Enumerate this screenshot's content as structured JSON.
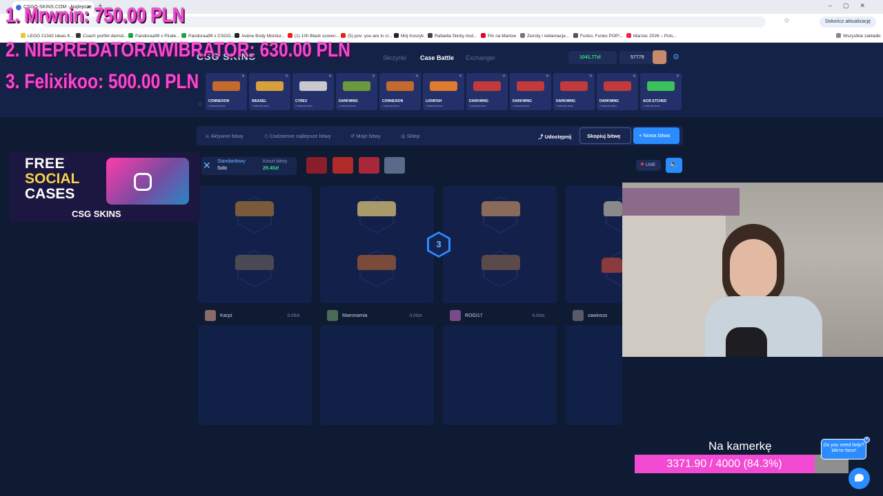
{
  "browser": {
    "tab_title": "CSGO-SKINS.COM - Najlepsze",
    "update_label": "Dokończ aktualizację",
    "bookmarks": [
      "LEGO 21342 Ideas K...",
      "Coach portfel damsk...",
      "Pandoraa99 x Pirate...",
      "Pandoraa99 x CSGO...",
      "Avène Body Moistur...",
      "(1) 10h Black screen...",
      "(5) pov: you are in cl...",
      "Mój Koszyk",
      "Rafaella Slinky And...",
      "Pin na Marlow",
      "Zwroty i reklamacje...",
      "Funko, Funko POP!...",
      "Marzec 2026 – Pols..."
    ],
    "all_bookmarks_label": "Wszystkie zakładki"
  },
  "leaderboard": [
    {
      "rank": "1. Mrwnin:",
      "amount": "750.00 PLN"
    },
    {
      "rank": "2. NIEPREDATORAWIBRATOR:",
      "amount": "630.00 PLN"
    },
    {
      "rank": "3. Felixikoo:",
      "amount": "500.00 PLN"
    }
  ],
  "site": {
    "logo": "CSG SKINS",
    "nav": [
      "Skrzynki",
      "Case Battle",
      "Exchanger"
    ],
    "balance": "1041.77zł",
    "points": "57779",
    "live_drops": [
      {
        "name": "CONNEXION",
        "color": "#c46a2c"
      },
      {
        "name": "WEASEL",
        "color": "#d6a03a"
      },
      {
        "name": "CYREX",
        "color": "#c8c9cc"
      },
      {
        "name": "DARKWING",
        "color": "#6a9a3c"
      },
      {
        "name": "CONNEXION",
        "color": "#c46a2c"
      },
      {
        "name": "LIONFISH",
        "color": "#e07a2e"
      },
      {
        "name": "DARKWING",
        "color": "#c23a3a"
      },
      {
        "name": "DARKWING",
        "color": "#c23a3a"
      },
      {
        "name": "DARKWING",
        "color": "#c23a3a"
      },
      {
        "name": "DARKWING",
        "color": "#c23a3a"
      },
      {
        "name": "ACID ETCHED",
        "color": "#3cc25a"
      }
    ],
    "drop_subtitle": "2 sekundy temu"
  },
  "battle_nav": {
    "active": "Aktywne bitwy",
    "daily": "Codzienne najlepsze bitwy",
    "mine": "Moje bitwy",
    "shop": "Sklep",
    "share": "Udostępnij",
    "copy": "Skopiuj bitwę",
    "new": "+ Nowa bitwa"
  },
  "battle": {
    "mode": "Standardowy",
    "mode_sub": "Solo",
    "cost_label": "Koszt bitwy",
    "cost": "29.40zł",
    "live_label": "LIVE",
    "round": "3",
    "players": [
      {
        "name": "Kacpi",
        "amount": "0.00zł"
      },
      {
        "name": "Mammamia",
        "amount": "0.00zł"
      },
      {
        "name": "ROGI17",
        "amount": "0.00zł"
      },
      {
        "name": "zawiosss",
        "amount": ""
      }
    ]
  },
  "promo": {
    "line1": "FREE",
    "line2": "SOCIAL",
    "line3": "CASES",
    "brand": "CSG SKINS"
  },
  "goal": {
    "title": "Na kamerkę",
    "text": "3371.90 / 4000 (84.3%)",
    "progress": 0.843
  },
  "help": {
    "text": "Do you need help? We're here!"
  }
}
